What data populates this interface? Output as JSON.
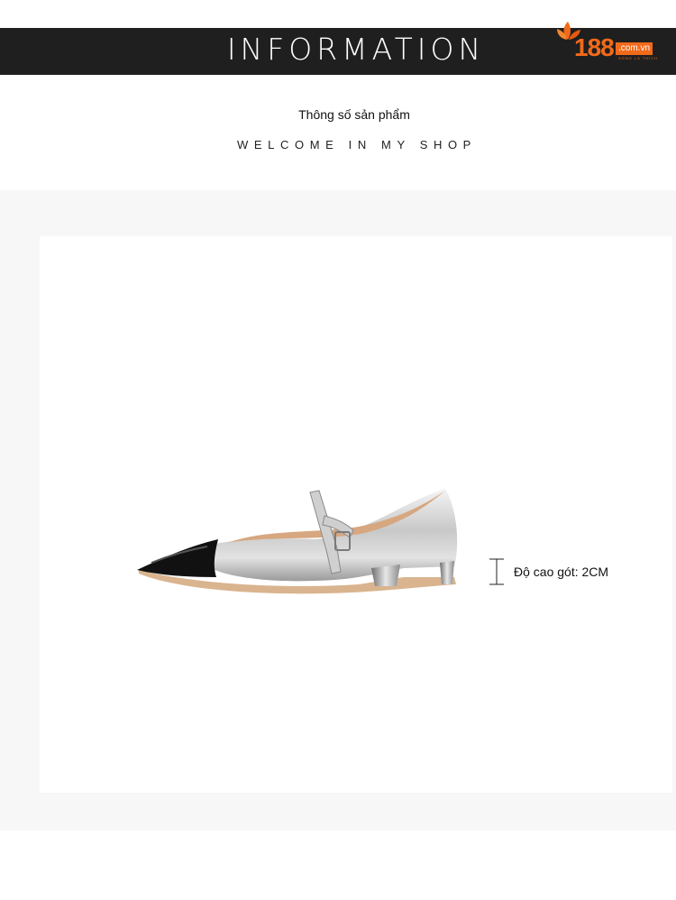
{
  "banner": {
    "title": "INFORMATION",
    "logo": {
      "number": "188",
      "domain": ".com.vn",
      "tagline": "SỐNG LÀ THÍCH"
    }
  },
  "header": {
    "subtitle": "Thông số sản phẩm",
    "welcome": "WELCOME IN MY SHOP"
  },
  "product": {
    "image": "silver-pointed-toe-mary-jane-flat-shoe",
    "heel_label": "Độ cao gót: 2CM"
  },
  "colors": {
    "banner_bg": "#1f1f1f",
    "brand_orange": "#f26a1b",
    "band_bg": "#f7f7f7"
  }
}
